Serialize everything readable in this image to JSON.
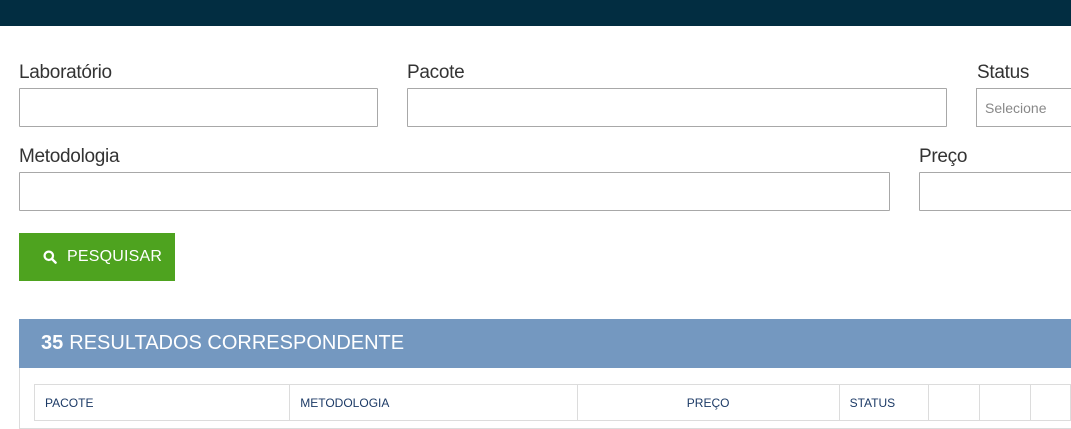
{
  "form": {
    "laboratorio_label": "Laboratório",
    "laboratorio_value": "",
    "pacote_label": "Pacote",
    "pacote_value": "",
    "status_label": "Status",
    "status_selected": "Selecione",
    "metodologia_label": "Metodologia",
    "metodologia_value": "",
    "preco_label": "Preço",
    "preco_value": ""
  },
  "search_button": {
    "label": "PESQUISAR",
    "icon": "search-icon"
  },
  "results": {
    "count": "35",
    "label": "RESULTADOS CORRESPONDENTE",
    "columns": [
      "PACOTE",
      "METODOLOGIA",
      "PREÇO",
      "STATUS",
      "",
      "",
      ""
    ]
  },
  "colors": {
    "topbar": "#022d41",
    "button": "#4ea31f",
    "results_header": "#7498c0",
    "table_text": "#1c3a66"
  }
}
